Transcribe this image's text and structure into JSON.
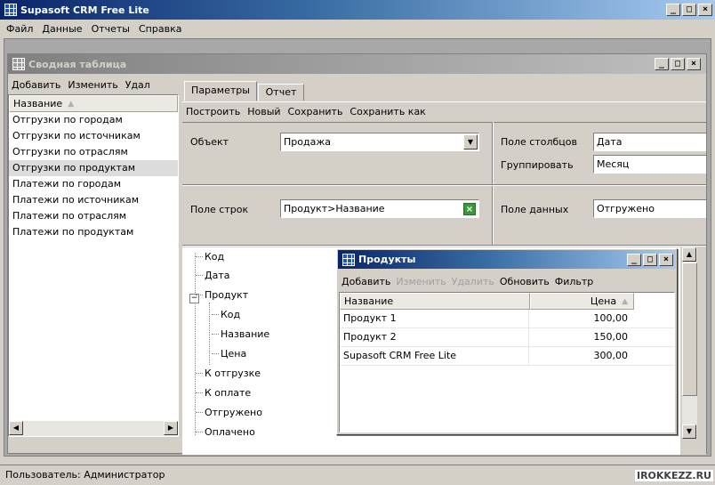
{
  "app": {
    "title": "Supasoft CRM Free Lite",
    "controls": {
      "minimize": "_",
      "maximize": "□",
      "close": "×"
    }
  },
  "menu": [
    "Файл",
    "Данные",
    "Отчеты",
    "Справка"
  ],
  "pivot_window": {
    "title": "Сводная таблица",
    "toolbar": [
      "Добавить",
      "Изменить",
      "Удал"
    ],
    "list_header": "Название",
    "list_sort_icon": "sort-up-icon",
    "list_items": [
      "Отгрузки по городам",
      "Отгрузки по источникам",
      "Отгрузки по отраслям",
      "Отгрузки по продуктам",
      "Платежи по городам",
      "Платежи по источникам",
      "Платежи по отраслям",
      "Платежи по продуктам"
    ],
    "selected_item": "Отгрузки по продуктам",
    "tabs": [
      "Параметры",
      "Отчет"
    ],
    "active_tab": "Параметры",
    "actions": [
      "Построить",
      "Новый",
      "Сохранить",
      "Сохранить как"
    ],
    "object_label": "Объект",
    "object_value": "Продажа",
    "columns_field_label": "Поле столбцов",
    "columns_field_value": "Дата",
    "group_label": "Группировать",
    "group_value": "Месяц",
    "rows_field_label": "Поле строк",
    "rows_field_value": "Продукт>Название",
    "data_field_label": "Поле данных",
    "data_field_value": "Отгружено",
    "tree": [
      "Код",
      "Дата",
      "Продукт",
      "Код",
      "Название",
      "Цена",
      "К отгрузке",
      "К оплате",
      "Отгружено",
      "Оплачено"
    ],
    "tree_expander": "−"
  },
  "products_dialog": {
    "title": "Продукты",
    "toolbar": {
      "add": "Добавить",
      "edit": "Изменить",
      "delete": "Удалить",
      "refresh": "Обновить",
      "filter": "Фильтр"
    },
    "columns": [
      "Название",
      "Цена"
    ],
    "rows": [
      {
        "name": "Продукт 1",
        "price": "100,00"
      },
      {
        "name": "Продукт 2",
        "price": "150,00"
      },
      {
        "name": "Supasoft CRM Free Lite",
        "price": "300,00"
      }
    ]
  },
  "status_bar": {
    "text": "Пользователь: Администратор"
  },
  "watermark": "IROKKEZZ.RU",
  "colors": {
    "title_active": "#0a246a",
    "title_inactive": "#808080",
    "face": "#d4d0c8",
    "selection": "#dcdcdc",
    "disabled_text": "#a0a0a0",
    "clear_button": "#3a9a3a"
  }
}
